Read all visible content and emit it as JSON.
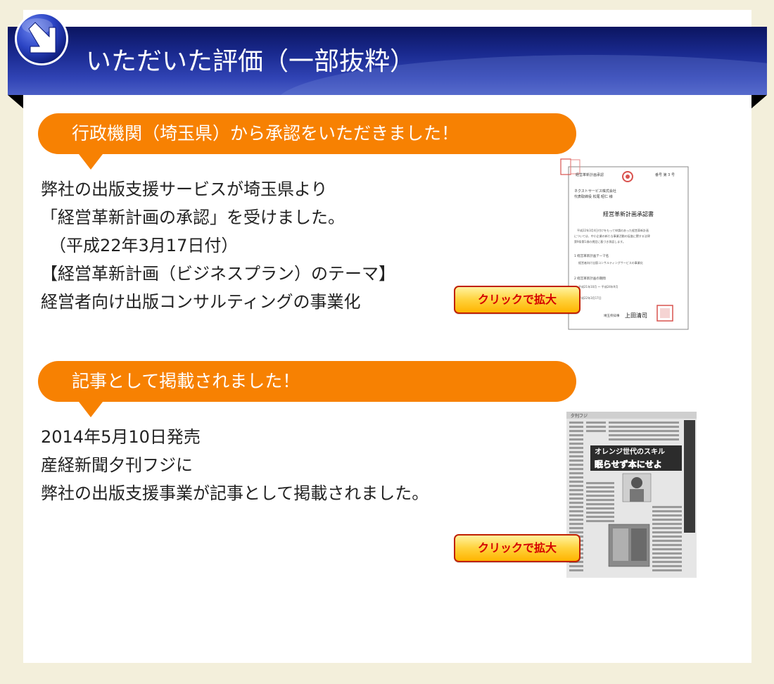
{
  "header": {
    "title": "いただいた評価（一部抜粋）",
    "icon": "arrow-down-right-icon"
  },
  "sections": [
    {
      "label": "行政機関（埼玉県）から承認をいただきました！",
      "lines": [
        "弊社の出版支援サービスが埼玉県より",
        "「経営革新計画の承認」を受けました。",
        "（平成22年3月17日付）",
        "【経営革新計画（ビジネスプラン）のテーマ】",
        "経営者向け出版コンサルティングの事業化"
      ],
      "button": "クリックで拡大",
      "document": {
        "header_left": "経営革新計画承認",
        "header_right": "番号 第 3 号",
        "addressee_1": "ネクストサービス株式会社",
        "addressee_2": "代表取締役 松尾 昭仁 様",
        "title": "経営革新計画承認書",
        "body_1": "平成22年3月4日付けをもって申請のあった経営革新計画",
        "body_2": "については、中小企業の新たな事業活動の促進に関する法律",
        "body_3": "第9条第1項の規定に基づき承認します。",
        "item_1": "1 経営革新計画テーマ名",
        "item_1_value": "経営者向け出版コンサルティングサービスの事業化",
        "item_2": "2 経営革新計画の期間",
        "item_2_value": "平成21年10月 ～ 平成24年9月",
        "date": "平成22年3月17日",
        "signer_role": "埼玉県知事",
        "signer": "上田清司"
      }
    },
    {
      "label": "記事として掲載されました！",
      "lines": [
        "2014年5月10日発売",
        "産経新聞夕刊フジに",
        "弊社の出版支援事業が記事として掲載されました。"
      ],
      "button": "クリックで拡大",
      "newspaper": {
        "masthead": "夕刊フジ",
        "headline_1": "オレンジ世代のスキル",
        "headline_2": "眠らせず本にせよ"
      }
    }
  ],
  "colors": {
    "page_bg": "#f3efdb",
    "card_bg": "#ffffff",
    "ribbon": "#1a2a90",
    "bubble": "#f78102",
    "button_text": "#d40000"
  }
}
